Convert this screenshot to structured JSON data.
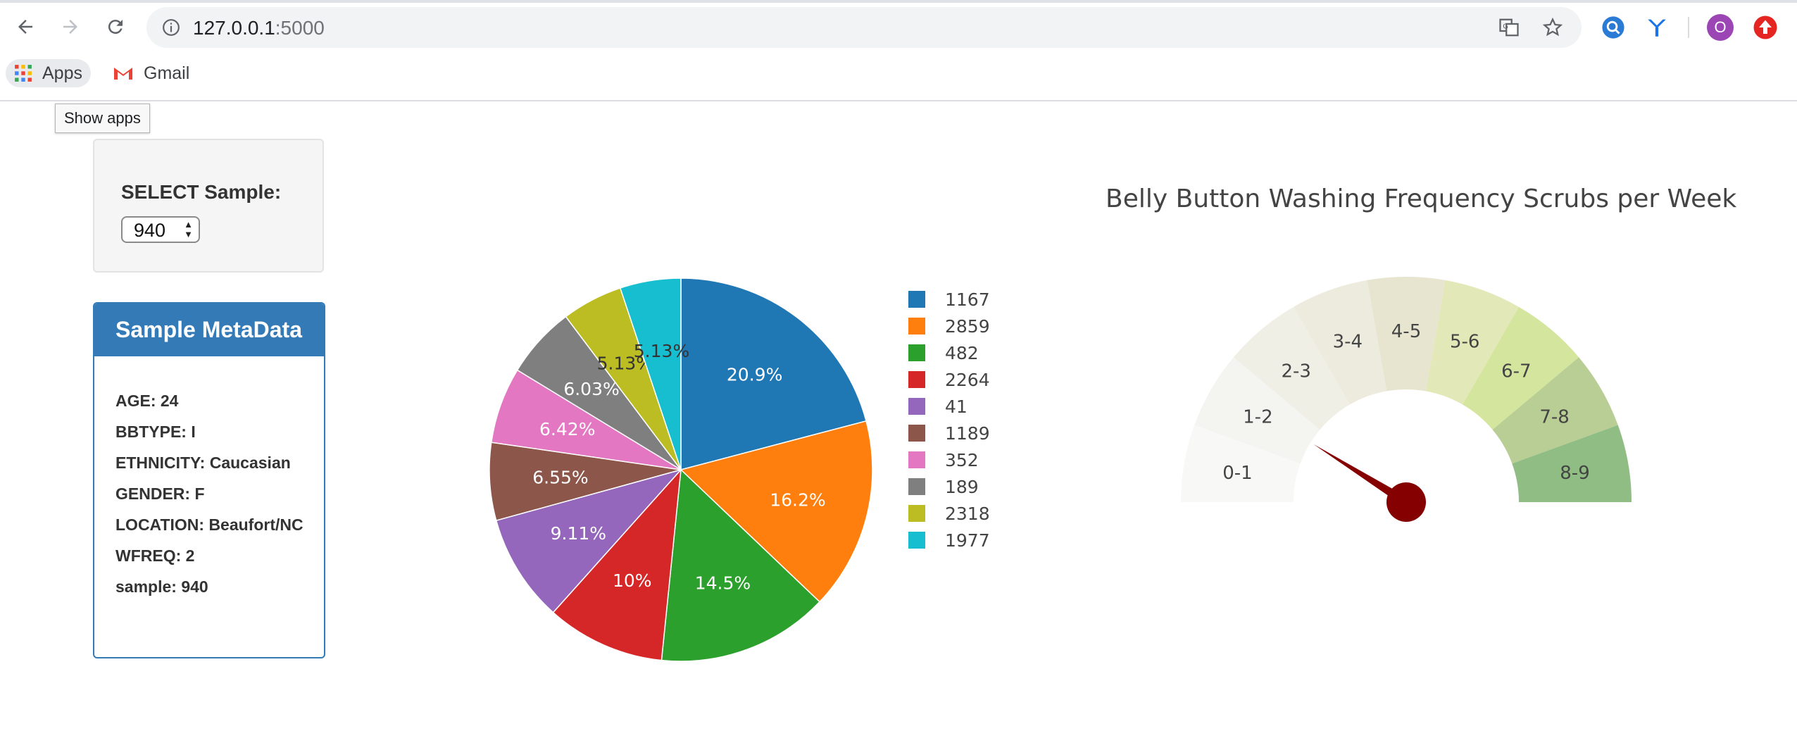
{
  "browser": {
    "url_host": "127.0.0.1",
    "url_port": ":5000",
    "bookmarks": [
      {
        "label": "Apps",
        "icon": "apps-grid-icon"
      },
      {
        "label": "Gmail",
        "icon": "gmail-icon"
      }
    ],
    "tooltip": "Show apps",
    "profile_initial": "O"
  },
  "selector": {
    "label": "SELECT Sample:",
    "value": "940"
  },
  "metadata": {
    "title": "Sample MetaData",
    "rows": [
      "AGE: 24",
      "BBTYPE: I",
      "ETHNICITY: Caucasian",
      "GENDER: F",
      "LOCATION: Beaufort/NC",
      "WFREQ: 2",
      "sample: 940"
    ]
  },
  "chart_data": [
    {
      "type": "pie",
      "labels": [
        "1167",
        "2859",
        "482",
        "2264",
        "41",
        "1189",
        "352",
        "189",
        "2318",
        "1977"
      ],
      "values": [
        20.9,
        16.2,
        14.5,
        10,
        9.11,
        6.55,
        6.42,
        6.03,
        5.13,
        5.13
      ],
      "slice_labels": [
        "20.9%",
        "16.2%",
        "14.5%",
        "10%",
        "9.11%",
        "6.55%",
        "6.42%",
        "6.03%",
        "5.13%",
        "5.13%"
      ],
      "colors": [
        "#1f77b4",
        "#ff7f0e",
        "#2ca02c",
        "#d62728",
        "#9467bd",
        "#8c564b",
        "#e377c2",
        "#7f7f7f",
        "#bcbd22",
        "#17becf"
      ],
      "legend_position": "right"
    },
    {
      "type": "gauge",
      "title": "Belly Button Washing Frequency Scrubs per Week",
      "bands": [
        "0-1",
        "1-2",
        "2-3",
        "3-4",
        "4-5",
        "5-6",
        "6-7",
        "7-8",
        "8-9"
      ],
      "band_colors": [
        "#f8f8f6",
        "#f4f4f0",
        "#f0efe6",
        "#edebdd",
        "#e7e5d0",
        "#e3e8b8",
        "#d4e59e",
        "#b9ce95",
        "#8fbd84"
      ],
      "range": [
        0,
        9
      ],
      "value": 2,
      "needle_color": "#850000"
    }
  ]
}
